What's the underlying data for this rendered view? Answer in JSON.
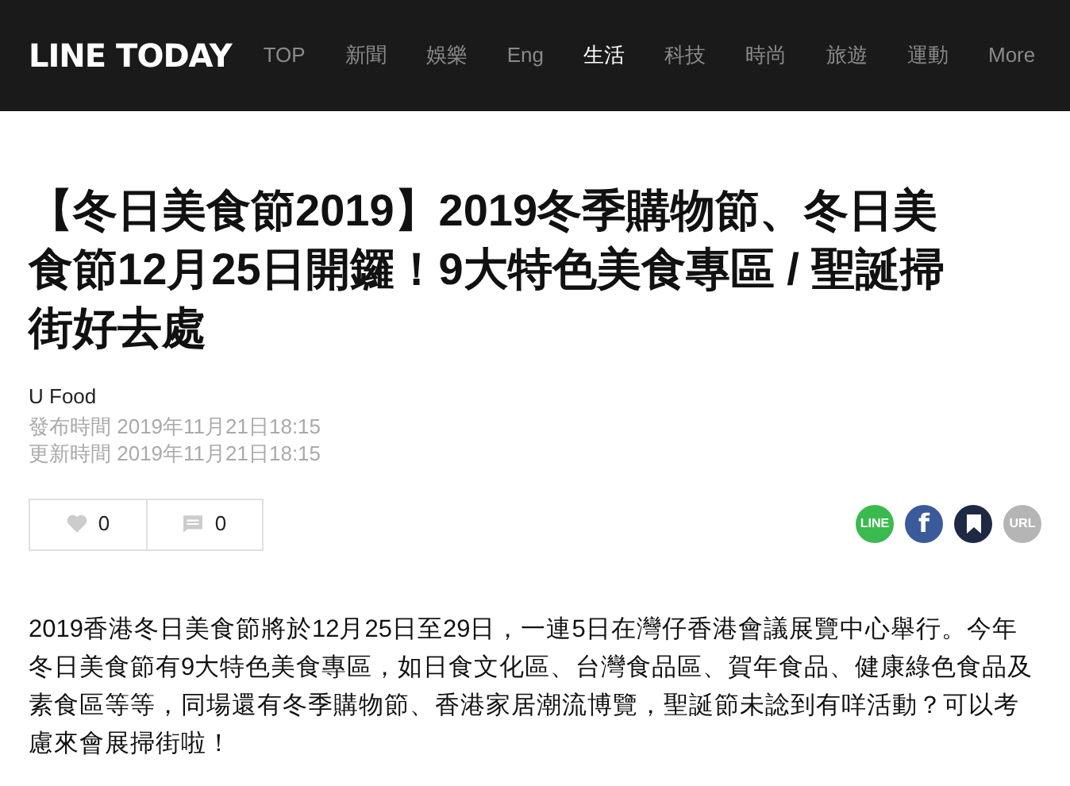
{
  "header": {
    "logo": "LINE TODAY",
    "nav": [
      {
        "label": "TOP",
        "selected": false
      },
      {
        "label": "新聞",
        "selected": false
      },
      {
        "label": "娛樂",
        "selected": false
      },
      {
        "label": "Eng",
        "selected": false
      },
      {
        "label": "生活",
        "selected": true
      },
      {
        "label": "科技",
        "selected": false
      },
      {
        "label": "時尚",
        "selected": false
      },
      {
        "label": "旅遊",
        "selected": false
      },
      {
        "label": "運動",
        "selected": false
      },
      {
        "label": "More",
        "selected": false
      }
    ]
  },
  "article": {
    "title": "【冬日美食節2019】2019冬季購物節、冬日美食節12月25日開鑼！9大特色美食專區 / 聖誕掃街好去處",
    "author": "U Food",
    "published": "發布時間 2019年11月21日18:15",
    "updated": "更新時間 2019年11月21日18:15",
    "reactions": [
      {
        "kind": "like",
        "count": "0"
      },
      {
        "kind": "comment",
        "count": "0"
      }
    ],
    "share": [
      {
        "kind": "line",
        "label": "LINE"
      },
      {
        "kind": "facebook",
        "label": "f"
      },
      {
        "kind": "bookmark"
      },
      {
        "kind": "url",
        "label": "URL"
      }
    ],
    "body": "2019香港冬日美食節將於12月25日至29日，一連5日在灣仔香港會議展覽中心舉行。今年冬日美食節有9大特色美食專區，如日食文化區、台灣食品區、賀年食品、健康綠色食品及素食區等等，同場還有冬季購物節、香港家居潮流博覽，聖誕節未諗到有咩活動？可以考慮來會展掃街啦！"
  }
}
